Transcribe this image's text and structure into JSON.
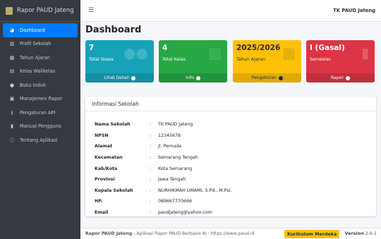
{
  "brand": {
    "title": "Rapor PAUD Jateng"
  },
  "topbar": {
    "school": "TK PAUD Jateng"
  },
  "sidebar": {
    "items": [
      {
        "label": "Dashboard",
        "icon": "dashboard-icon",
        "active": true
      },
      {
        "label": "Profil Sekolah",
        "icon": "school-icon"
      },
      {
        "label": "Tahun Ajaran",
        "icon": "calendar-icon"
      },
      {
        "label": "Kelas Walikelas",
        "icon": "class-icon"
      },
      {
        "label": "Buku Induk",
        "icon": "users-icon"
      },
      {
        "label": "Manajemen Rapor",
        "icon": "report-icon"
      },
      {
        "label": "Pengaturan API",
        "icon": "key-icon"
      },
      {
        "label": "Manual Pengguna",
        "icon": "book-icon"
      },
      {
        "label": "Tentang Aplikasi",
        "icon": "info-icon"
      }
    ]
  },
  "page": {
    "title": "Dashboard"
  },
  "boxes": [
    {
      "value": "7",
      "label": "Total Siswa",
      "link": "Lihat Detail",
      "icon": "users-icon",
      "color": "#17a2b8"
    },
    {
      "value": "4",
      "label": "Total Kelas",
      "link": "Info",
      "icon": "school-icon",
      "color": "#28a745"
    },
    {
      "value": "2025/2026",
      "label": "Tahun Ajaran",
      "link": "Pengaturan",
      "icon": "calendar-icon",
      "color": "#ffc107"
    },
    {
      "value": "I (Gasal)",
      "label": "Semester",
      "link": "Rapor",
      "icon": "book-icon",
      "color": "#dc3545"
    }
  ],
  "school_info": {
    "title": "Informasi Sekolah",
    "rows": [
      {
        "key": "Nama Sekolah",
        "value": "TK PAUD Jateng"
      },
      {
        "key": "NPSN",
        "value": "12345678"
      },
      {
        "key": "Alamat",
        "value": "Jl. Pemuda"
      },
      {
        "key": "Kecamatan",
        "value": "Semarang Tengah"
      },
      {
        "key": "Kab/Kota",
        "value": "Kota Semarang"
      },
      {
        "key": "Provinsi",
        "value": "Jawa Tengah"
      },
      {
        "key": "Kepala Sekolah",
        "value": "NURHIKMAH UMAMI, S.Pd., M.Psi."
      },
      {
        "key": "HP.",
        "value": "089667770666"
      },
      {
        "key": "Email",
        "value": "paudjateng@yahoo.com"
      }
    ],
    "separator": ":"
  },
  "footer": {
    "app": "Rapor PAUD Jateng",
    "tagline": "- Aplikasi Rapor PAUD Berbasis AI · https://www.paud.id",
    "badge": "Kurikulum Merdeka",
    "version_label": "Version",
    "version": "2.6.1"
  }
}
